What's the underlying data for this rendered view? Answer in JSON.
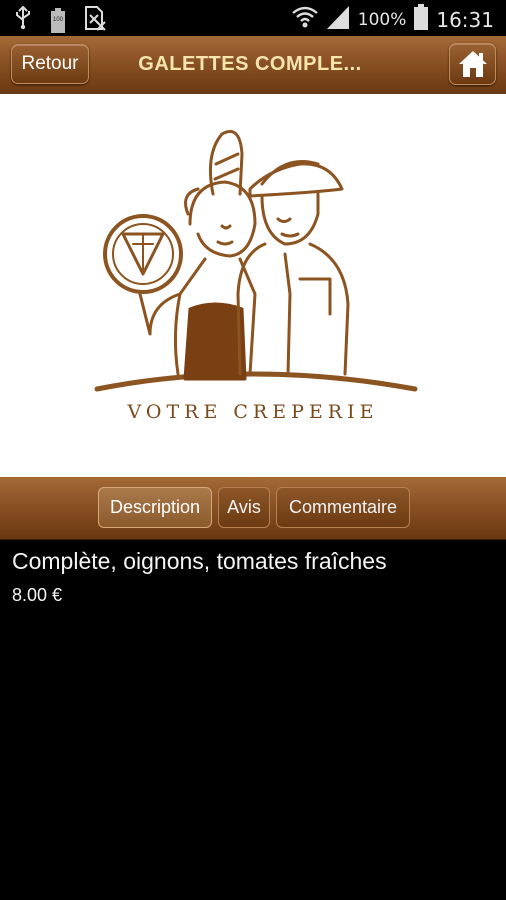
{
  "status_bar": {
    "battery_small_text": "100",
    "battery_percent": "100%",
    "time": "16:31",
    "icons": [
      "usb-icon",
      "battery-saver-icon",
      "sim-off-icon",
      "wifi-icon",
      "signal-icon",
      "battery-icon"
    ]
  },
  "header": {
    "back_label": "Retour",
    "title": "GALETTES COMPLE...",
    "home_icon": "home-icon"
  },
  "hero": {
    "logo_text": "VOTRE CREPERIE",
    "brand_color": "#7a4a1c"
  },
  "tabs": [
    {
      "label": "Description",
      "active": true
    },
    {
      "label": "Avis",
      "active": false
    },
    {
      "label": "Commentaire",
      "active": false
    }
  ],
  "product": {
    "description": "Complète, oignons, tomates fraîches",
    "price": "8.00 €"
  },
  "colors": {
    "bar_top": "#a56a37",
    "bar_bottom": "#6a3810",
    "title_text": "#f6e6ad",
    "background": "#000000"
  }
}
